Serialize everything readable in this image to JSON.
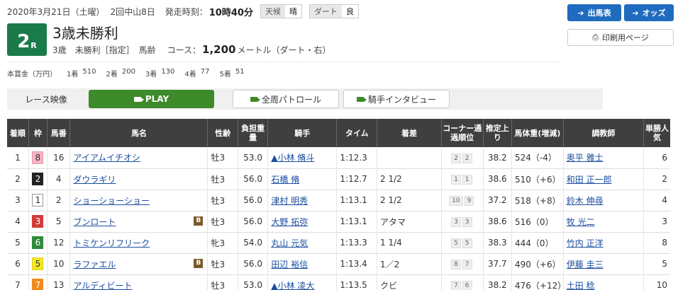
{
  "header": {
    "date": "2020年3月21日（土曜）",
    "kaisai": "2回中山8日",
    "start_label": "発走時刻：",
    "start_time": "10時40分",
    "weather_label": "天候",
    "weather": "晴",
    "track_label": "ダート",
    "track_cond": "良"
  },
  "race": {
    "num": "2",
    "r": "R",
    "name": "3歳未勝利",
    "cls": "3歳　未勝利［指定］　馬齢",
    "course_label": "コース：",
    "distance": "1,200",
    "unit": "メートル（ダート・右）"
  },
  "prize": {
    "label": "本賞金（万円）",
    "items": [
      {
        "rank": "1着",
        "val": "510"
      },
      {
        "rank": "2着",
        "val": "200"
      },
      {
        "rank": "3着",
        "val": "130"
      },
      {
        "rank": "4着",
        "val": "77"
      },
      {
        "rank": "5着",
        "val": "51"
      }
    ]
  },
  "actions": {
    "shutuba": "出馬表",
    "odds": "オッズ",
    "print": "印刷用ページ"
  },
  "media": {
    "race_video": "レース映像",
    "play": "PLAY",
    "patrol": "全周パトロール",
    "interview": "騎手インタビュー"
  },
  "table": {
    "headers": [
      "着順",
      "枠",
      "馬番",
      "馬名",
      "性齢",
      "負担重量",
      "騎手",
      "タイム",
      "着差",
      "コーナー通過順位",
      "推定上り",
      "馬体重(増減)",
      "調教師",
      "単勝人気"
    ],
    "rows": [
      {
        "rank": "1",
        "waku": "8",
        "umaban": "16",
        "horse": "アイアムイチオシ",
        "blinker": "",
        "sexage": "牡3",
        "weight": "53.0",
        "jockey": "▲小林 脩斗",
        "time": "1:12.3",
        "margin": "",
        "c1": "2",
        "c2": "2",
        "agari": "38.2",
        "body": "524（-4）",
        "trainer": "奥平 雅士",
        "pop": "6"
      },
      {
        "rank": "2",
        "waku": "2",
        "umaban": "4",
        "horse": "ダウラギリ",
        "blinker": "",
        "sexage": "牡3",
        "weight": "56.0",
        "jockey": "石橋 脩",
        "time": "1:12.7",
        "margin": "2 1/2",
        "c1": "1",
        "c2": "1",
        "agari": "38.6",
        "body": "510（+6）",
        "trainer": "和田 正一郎",
        "pop": "2"
      },
      {
        "rank": "3",
        "waku": "1",
        "umaban": "2",
        "horse": "ショーショーショー",
        "blinker": "",
        "sexage": "牡3",
        "weight": "56.0",
        "jockey": "津村 明秀",
        "time": "1:13.1",
        "margin": "2 1/2",
        "c1": "10",
        "c2": "9",
        "agari": "37.2",
        "body": "518（+8）",
        "trainer": "鈴木 伸尋",
        "pop": "4"
      },
      {
        "rank": "4",
        "waku": "3",
        "umaban": "5",
        "horse": "ブンロート",
        "blinker": "B",
        "sexage": "牡3",
        "weight": "56.0",
        "jockey": "大野 拓弥",
        "time": "1:13.1",
        "margin": "アタマ",
        "c1": "3",
        "c2": "3",
        "agari": "38.6",
        "body": "516（0）",
        "trainer": "牧 光二",
        "pop": "3"
      },
      {
        "rank": "5",
        "waku": "6",
        "umaban": "12",
        "horse": "トミケンリフリーク",
        "blinker": "",
        "sexage": "牝3",
        "weight": "54.0",
        "jockey": "丸山 元気",
        "time": "1:13.3",
        "margin": "1 1/4",
        "c1": "5",
        "c2": "5",
        "agari": "38.3",
        "body": "444（0）",
        "trainer": "竹内 正洋",
        "pop": "8"
      },
      {
        "rank": "6",
        "waku": "5",
        "umaban": "10",
        "horse": "ラファエル",
        "blinker": "B",
        "sexage": "牡3",
        "weight": "56.0",
        "jockey": "田辺 裕信",
        "time": "1:13.4",
        "margin": "1／2",
        "c1": "8",
        "c2": "7",
        "agari": "37.7",
        "body": "490（+6）",
        "trainer": "伊藤 圭三",
        "pop": "5"
      },
      {
        "rank": "7",
        "waku": "7",
        "umaban": "13",
        "horse": "アルディビート",
        "blinker": "",
        "sexage": "牡3",
        "weight": "53.0",
        "jockey": "▲小林 凌大",
        "time": "1:13.5",
        "margin": "クビ",
        "c1": "7",
        "c2": "6",
        "agari": "38.2",
        "body": "476（+12）",
        "trainer": "土田 稔",
        "pop": "10"
      }
    ]
  },
  "colors": {
    "badge_green": "#1a7a4a",
    "action_blue": "#1f6bbf",
    "play_green": "#3d8a2a",
    "header_dark": "#3f3f3f",
    "link_blue": "#1a4da0"
  }
}
